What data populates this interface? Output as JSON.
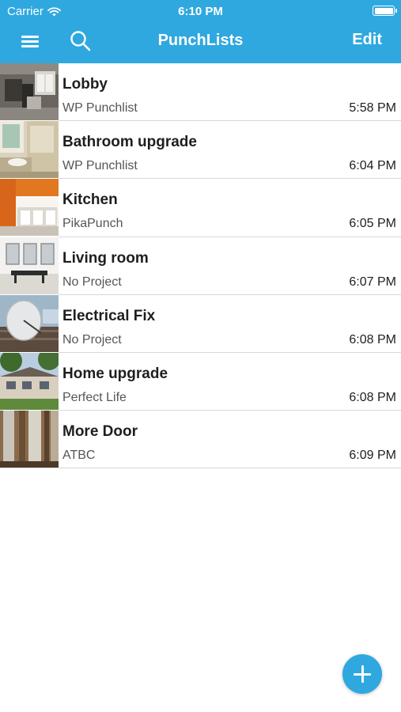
{
  "status_bar": {
    "carrier": "Carrier",
    "time": "6:10 PM"
  },
  "nav": {
    "title": "PunchLists",
    "edit_label": "Edit"
  },
  "punchlists": [
    {
      "title": "Lobby",
      "project": "WP Punchlist",
      "time": "5:58 PM"
    },
    {
      "title": "Bathroom upgrade",
      "project": "WP Punchlist",
      "time": "6:04 PM"
    },
    {
      "title": "Kitchen",
      "project": "PikaPunch",
      "time": "6:05 PM"
    },
    {
      "title": "Living room",
      "project": "No Project",
      "time": "6:07 PM"
    },
    {
      "title": "Electrical Fix",
      "project": "No Project",
      "time": "6:08 PM"
    },
    {
      "title": "Home upgrade",
      "project": "Perfect Life",
      "time": "6:08 PM"
    },
    {
      "title": "More Door",
      "project": "ATBC",
      "time": "6:09 PM"
    }
  ],
  "colors": {
    "accent": "#2fa8e0",
    "divider": "#d8d8d8",
    "subtitle": "#555555"
  },
  "icons": {
    "menu": "hamburger-icon",
    "search": "search-icon",
    "add": "plus-icon",
    "wifi": "wifi-icon",
    "battery": "battery-icon"
  }
}
